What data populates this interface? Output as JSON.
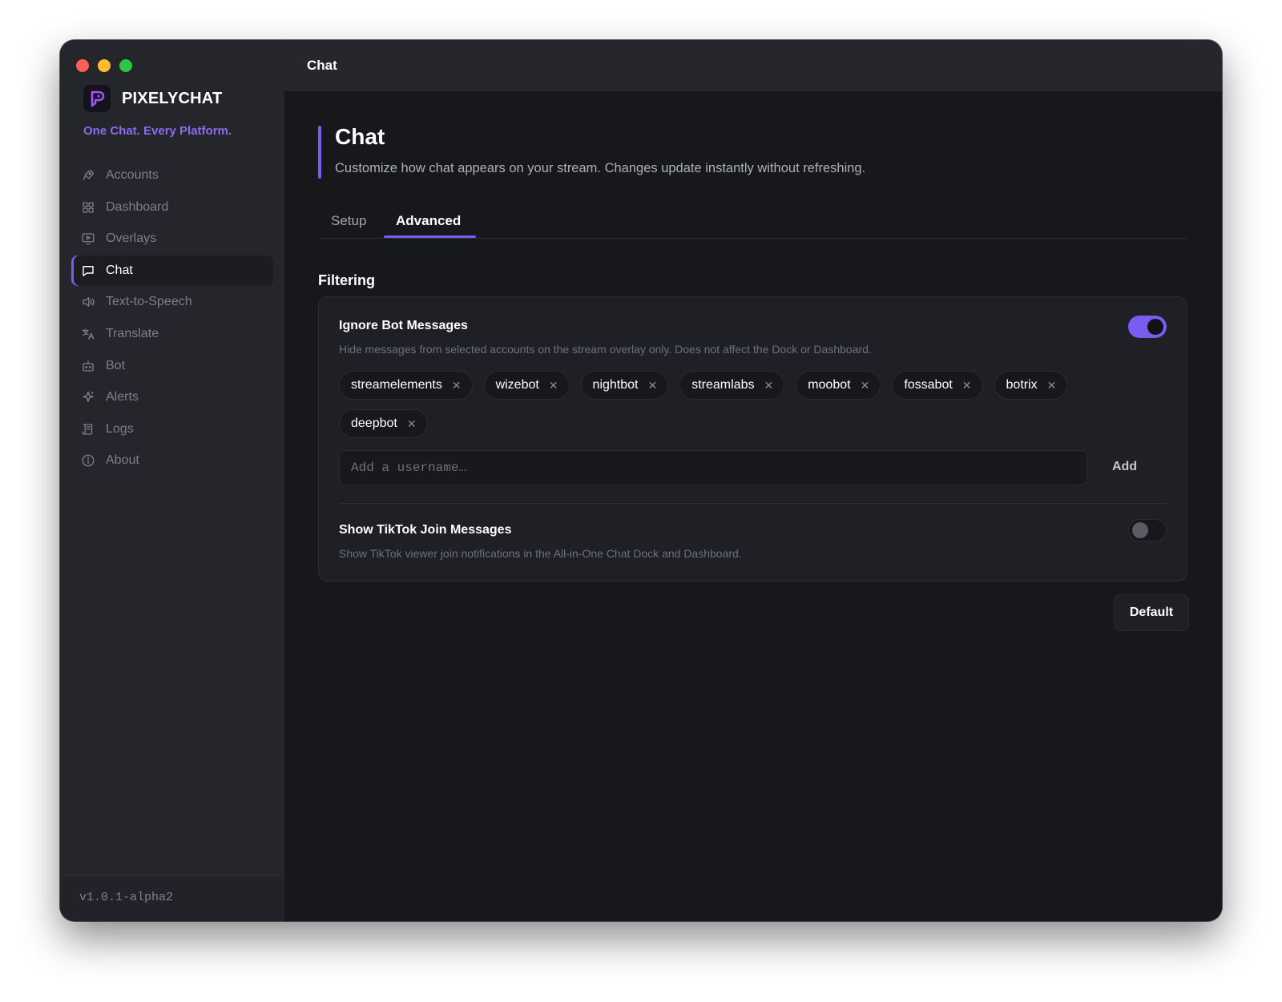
{
  "app": {
    "brand": "PIXELYCHAT",
    "tagline": "One Chat. Every Platform.",
    "version": "v1.0.1-alpha2",
    "accent_color": "#7b5cf0"
  },
  "header": {
    "title": "Chat"
  },
  "sidebar": {
    "items": [
      {
        "label": "Accounts",
        "icon": "rocket-icon",
        "active": false
      },
      {
        "label": "Dashboard",
        "icon": "grid-icon",
        "active": false
      },
      {
        "label": "Overlays",
        "icon": "monitor-play-icon",
        "active": false
      },
      {
        "label": "Chat",
        "icon": "message-square-icon",
        "active": true
      },
      {
        "label": "Text-to-Speech",
        "icon": "speaker-icon",
        "active": false
      },
      {
        "label": "Translate",
        "icon": "languages-icon",
        "active": false
      },
      {
        "label": "Bot",
        "icon": "bot-icon",
        "active": false
      },
      {
        "label": "Alerts",
        "icon": "sparkles-icon",
        "active": false
      },
      {
        "label": "Logs",
        "icon": "scroll-icon",
        "active": false
      },
      {
        "label": "About",
        "icon": "info-icon",
        "active": false
      }
    ]
  },
  "page": {
    "title": "Chat",
    "description": "Customize how chat appears on your stream. Changes update instantly without refreshing.",
    "tabs": [
      {
        "label": "Setup",
        "active": false
      },
      {
        "label": "Advanced",
        "active": true
      }
    ],
    "section_title": "Filtering"
  },
  "settings": {
    "ignore_bots": {
      "title": "Ignore Bot Messages",
      "description": "Hide messages from selected accounts on the stream overlay only. Does not affect the Dock or Dashboard.",
      "enabled": true,
      "usernames": [
        "streamelements",
        "wizebot",
        "nightbot",
        "streamlabs",
        "moobot",
        "fossabot",
        "botrix",
        "deepbot"
      ],
      "input_placeholder": "Add a username…",
      "input_value": "",
      "add_label": "Add",
      "remove_glyph": "✕"
    },
    "tiktok_join": {
      "title": "Show TikTok Join Messages",
      "description": "Show TikTok viewer join notifications in the All-in-One Chat Dock and Dashboard.",
      "enabled": false
    }
  },
  "actions": {
    "default_label": "Default"
  }
}
